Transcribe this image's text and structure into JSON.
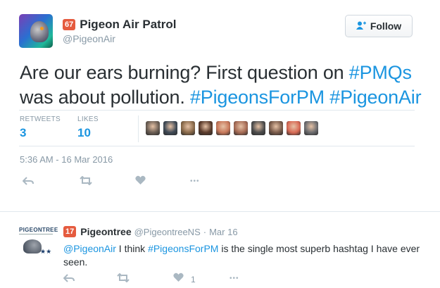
{
  "tweet": {
    "author_name": "Pigeon Air Patrol",
    "author_handle": "@PigeonAir",
    "badge": "67",
    "follow_label": "Follow",
    "text_plain_1": "Are our ears burning? First question on ",
    "tag_1": "#PMQs",
    "text_plain_2": "was about pollution. ",
    "tag_2": "#PigeonsForPM",
    "tag_3": "#PigeonAir",
    "retweets_label": "RETWEETS",
    "retweets_count": "3",
    "likes_label": "LIKES",
    "likes_count": "10",
    "timestamp": "5:36 AM - 16 Mar 2016",
    "liker_avatar_colors": [
      "#6b5e54",
      "#3f4a56",
      "#8a6a4a",
      "#5b3b2b",
      "#c8785a",
      "#a66b55",
      "#4d4d4d",
      "#7a5b4a",
      "#d86a55",
      "#6d6d70"
    ]
  },
  "reply": {
    "logo_text": "PIGEONTREE",
    "stars": "★★",
    "badge": "17",
    "author_name": "Pigeontree",
    "author_handle": "@PigeontreeNS",
    "separator": "·",
    "date": "Mar 16",
    "mention": "@PigeonAir",
    "text_1": " I think ",
    "tag": "#PigeonsForPM",
    "text_2": " is the single most superb hashtag I have ever seen.",
    "like_count": "1"
  },
  "icons": {
    "reply": "↶",
    "retweet": "⇄",
    "like": "♥",
    "more": "•••",
    "follow_person": "👤+"
  },
  "colors": {
    "accent": "#1b95e0",
    "badge": "#e55b3f",
    "muted": "#8899a6"
  }
}
